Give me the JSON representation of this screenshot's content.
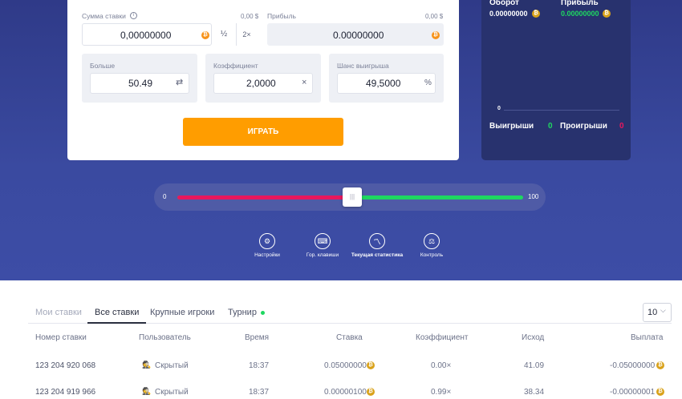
{
  "bet_form": {
    "bet_amount_label": "Сумма ставки",
    "bet_amount_usd": "0,00 $",
    "bet_amount_value": "0,00000000",
    "half_label": "½",
    "double_label": "2×",
    "profit_label": "Прибыль",
    "profit_usd": "0,00 $",
    "profit_value": "0.00000000",
    "over_label": "Больше",
    "over_value": "50.49",
    "multiplier_label": "Коэффициент",
    "multiplier_value": "2,0000",
    "multiplier_suffix": "×",
    "chance_label": "Шанс выигрыша",
    "chance_value": "49,5000",
    "chance_suffix": "%",
    "play_label": "ИГРАТЬ"
  },
  "stats": {
    "turnover_label": "Оборот",
    "turnover_value": "0.00000000",
    "profit_label": "Прибыль",
    "profit_value": "0.00000000",
    "chart_zero": "0",
    "wins_label": "Выигрыши",
    "wins_value": "0",
    "losses_label": "Проигрыши",
    "losses_value": "0"
  },
  "slider": {
    "min_label": "0",
    "max_label": "100",
    "value": 50.49
  },
  "tools": [
    {
      "label": "Настройки",
      "icon": "gear-icon"
    },
    {
      "label": "Гор. клавиши",
      "icon": "keyboard-icon"
    },
    {
      "label": "Текущая статистика",
      "icon": "chart-icon"
    },
    {
      "label": "Контроль",
      "icon": "scale-icon"
    }
  ],
  "tabs": [
    {
      "label": "Мои ставки"
    },
    {
      "label": "Все ставки"
    },
    {
      "label": "Крупные игроки"
    },
    {
      "label": "Турнир"
    }
  ],
  "page_size": "10",
  "table": {
    "headers": [
      "Номер ставки",
      "Пользователь",
      "Время",
      "Ставка",
      "Коэффициент",
      "Исход",
      "Выплата"
    ],
    "rows": [
      [
        "123 204 920 068",
        "Скрытый",
        "18:37",
        "0.05000000",
        "0.00×",
        "41.09",
        "-0.05000000"
      ],
      [
        "123 204 919 966",
        "Скрытый",
        "18:37",
        "0.00000100",
        "0.99×",
        "38.34",
        "-0.00000001"
      ]
    ]
  },
  "colors": {
    "accent_orange": "#ff9d00",
    "win_green": "#1ed760",
    "loss_red": "#e8175d",
    "hero_blue": "#3a4aa0"
  }
}
